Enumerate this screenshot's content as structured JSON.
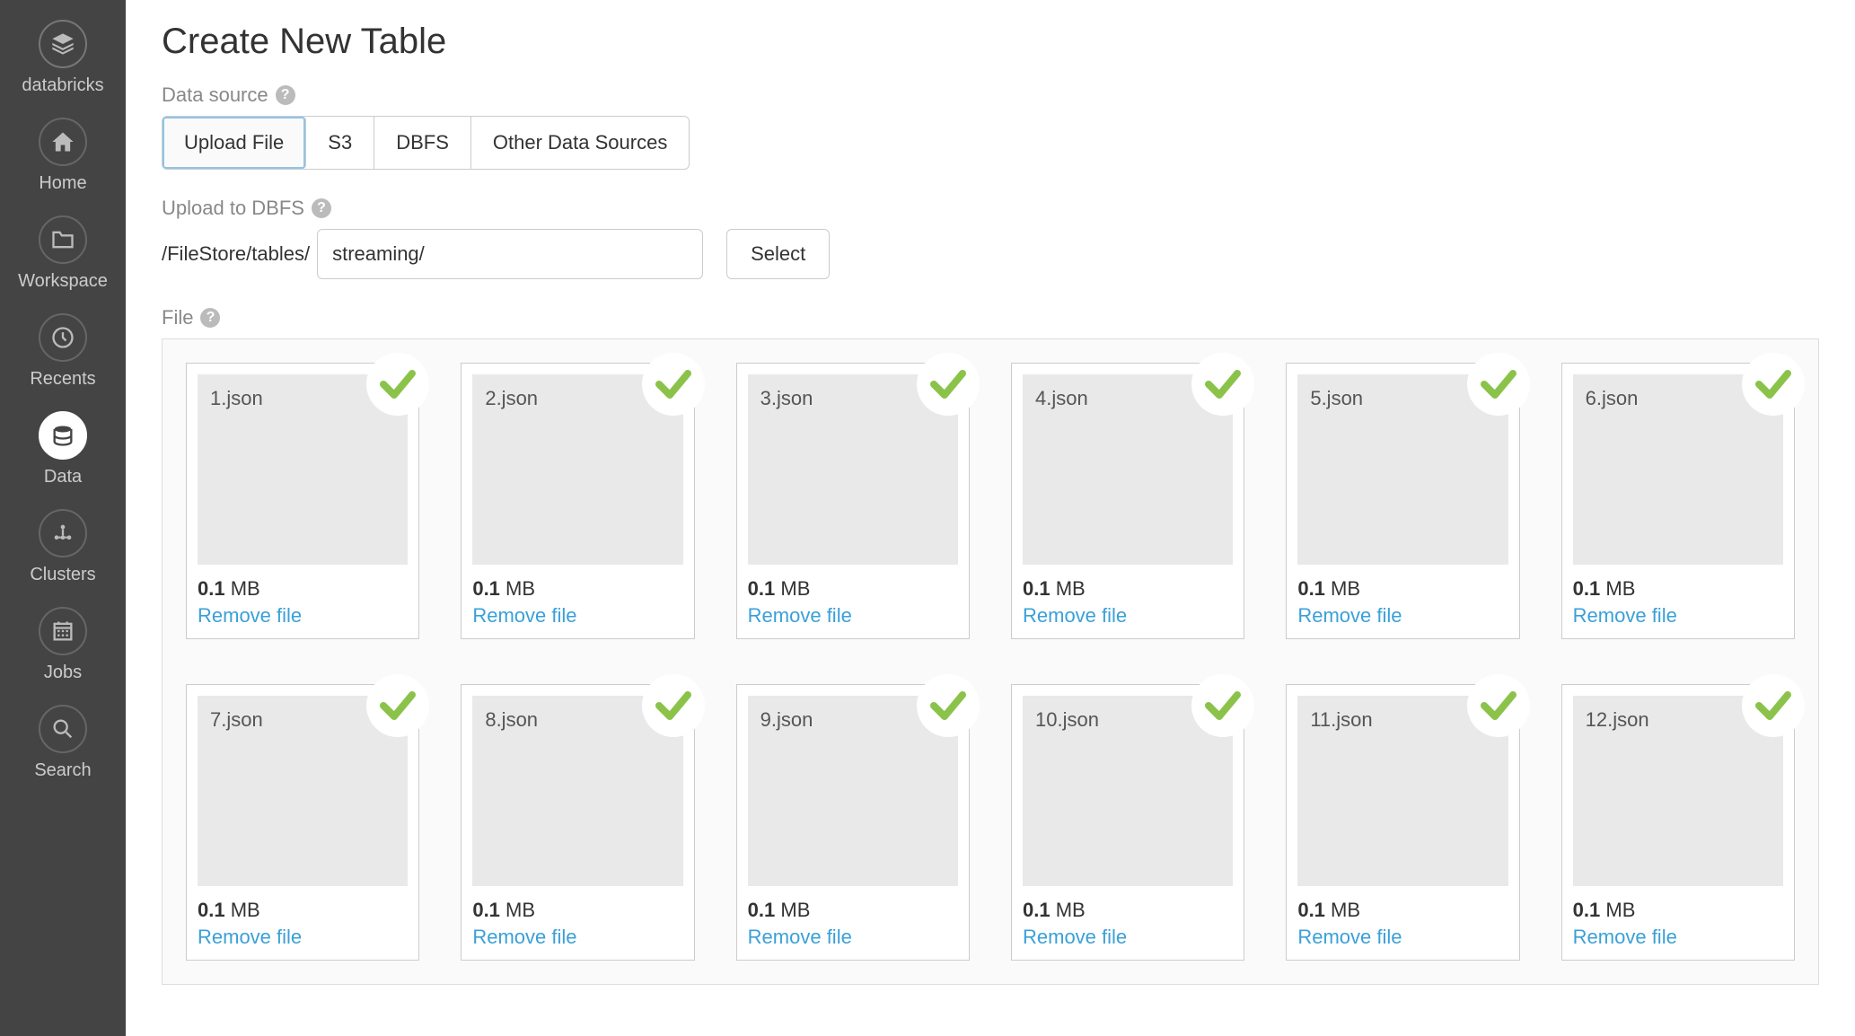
{
  "brand": "databricks",
  "sidebar": {
    "items": [
      {
        "label": "Home"
      },
      {
        "label": "Workspace"
      },
      {
        "label": "Recents"
      },
      {
        "label": "Data"
      },
      {
        "label": "Clusters"
      },
      {
        "label": "Jobs"
      },
      {
        "label": "Search"
      }
    ]
  },
  "page": {
    "title": "Create New Table",
    "data_source_label": "Data source",
    "tabs": [
      {
        "label": "Upload File"
      },
      {
        "label": "S3"
      },
      {
        "label": "DBFS"
      },
      {
        "label": "Other Data Sources"
      }
    ],
    "upload_to_label": "Upload to DBFS",
    "path_prefix": "/FileStore/tables/",
    "path_value": "streaming/",
    "select_btn": "Select",
    "file_label": "File",
    "size_unit": "MB",
    "remove_label": "Remove file",
    "files": [
      {
        "name": "1.json",
        "size": "0.1"
      },
      {
        "name": "2.json",
        "size": "0.1"
      },
      {
        "name": "3.json",
        "size": "0.1"
      },
      {
        "name": "4.json",
        "size": "0.1"
      },
      {
        "name": "5.json",
        "size": "0.1"
      },
      {
        "name": "6.json",
        "size": "0.1"
      },
      {
        "name": "7.json",
        "size": "0.1"
      },
      {
        "name": "8.json",
        "size": "0.1"
      },
      {
        "name": "9.json",
        "size": "0.1"
      },
      {
        "name": "10.json",
        "size": "0.1"
      },
      {
        "name": "11.json",
        "size": "0.1"
      },
      {
        "name": "12.json",
        "size": "0.1"
      }
    ]
  }
}
